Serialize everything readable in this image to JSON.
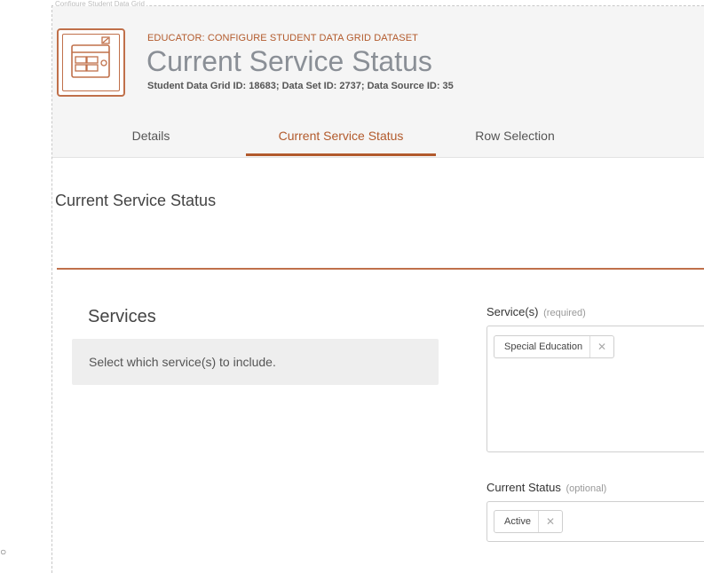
{
  "frame": {
    "caption": "Configure Student Data Grid"
  },
  "header": {
    "eyebrow": "EDUCATOR: CONFIGURE STUDENT DATA GRID DATASET",
    "title": "Current Service Status",
    "ids": "Student Data Grid ID: 18683; Data Set ID: 2737; Data Source ID: 35",
    "icon": "data-grid-config-icon"
  },
  "tabs": [
    {
      "label": "Details",
      "active": false
    },
    {
      "label": "Current Service Status",
      "active": true
    },
    {
      "label": "Row Selection",
      "active": false
    }
  ],
  "page": {
    "section_title": "Current Service Status"
  },
  "services_panel": {
    "heading": "Services",
    "description": "Select which service(s) to include."
  },
  "fields": {
    "services": {
      "label": "Service(s)",
      "hint": "(required)",
      "chips": [
        {
          "label": "Special Education",
          "remove_icon": "close-icon"
        }
      ]
    },
    "current_status": {
      "label": "Current Status",
      "hint": "(optional)",
      "chips": [
        {
          "label": "Active",
          "remove_icon": "close-icon"
        }
      ]
    }
  },
  "colors": {
    "accent": "#b25a2c",
    "header_bg": "#f5f5f5",
    "title_gray": "#8a8f96",
    "info_bg": "#eeeeee"
  }
}
